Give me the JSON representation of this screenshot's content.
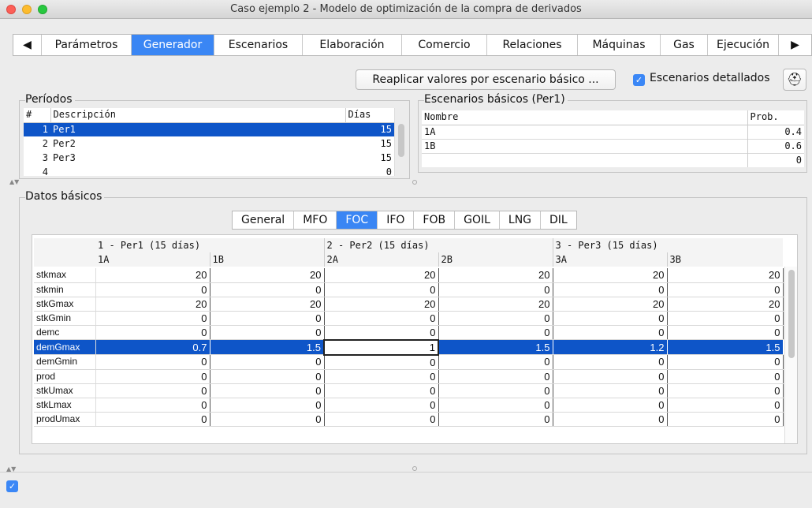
{
  "window": {
    "title": "Caso ejemplo 2 - Modelo de optimización de la compra de derivados"
  },
  "tabs": {
    "prev": "◀",
    "next": "▶",
    "items": [
      "Parámetros",
      "Generador",
      "Escenarios",
      "Elaboración",
      "Comercio",
      "Relaciones",
      "Máquinas",
      "Gas",
      "Ejecución"
    ],
    "active": "Generador"
  },
  "toolbar": {
    "replicate_label": "Reaplicar valores por escenario básico ...",
    "detailed_label": "Escenarios detallados",
    "detailed_checked": true
  },
  "periods": {
    "legend": "Períodos",
    "headers": {
      "num": "#",
      "desc": "Descripción",
      "days": "Días"
    },
    "rows": [
      {
        "num": "1",
        "desc": "Per1",
        "days": "15"
      },
      {
        "num": "2",
        "desc": "Per2",
        "days": "15"
      },
      {
        "num": "3",
        "desc": "Per3",
        "days": "15"
      },
      {
        "num": "4",
        "desc": "",
        "days": "0"
      }
    ]
  },
  "scenarios": {
    "legend": "Escenarios básicos (Per1)",
    "headers": {
      "name": "Nombre",
      "prob": "Prob."
    },
    "rows": [
      {
        "name": "1A",
        "prob": "0.4"
      },
      {
        "name": "1B",
        "prob": "0.6"
      },
      {
        "name": "",
        "prob": "0"
      }
    ]
  },
  "basic": {
    "legend": "Datos básicos",
    "subtabs": [
      "General",
      "MFO",
      "FOC",
      "IFO",
      "FOB",
      "GOIL",
      "LNG",
      "DIL"
    ],
    "active_subtab": "FOC"
  },
  "grid": {
    "period_headers": [
      "1 - Per1 (15 días)",
      "2 - Per2 (15 días)",
      "3 - Per3 (15 días)"
    ],
    "scenario_headers": [
      "1A",
      "1B",
      "2A",
      "2B",
      "3A",
      "3B"
    ],
    "rows": [
      {
        "label": "stkmax",
        "values": [
          "20",
          "20",
          "20",
          "20",
          "20",
          "20"
        ]
      },
      {
        "label": "stkmin",
        "values": [
          "0",
          "0",
          "0",
          "0",
          "0",
          "0"
        ]
      },
      {
        "label": "stkGmax",
        "values": [
          "20",
          "20",
          "20",
          "20",
          "20",
          "20"
        ]
      },
      {
        "label": "stkGmin",
        "values": [
          "0",
          "0",
          "0",
          "0",
          "0",
          "0"
        ]
      },
      {
        "label": "demc",
        "values": [
          "0",
          "0",
          "0",
          "0",
          "0",
          "0"
        ]
      },
      {
        "label": "demGmax",
        "values": [
          "0.7",
          "1.5",
          "1",
          "1.5",
          "1.2",
          "1.5"
        ]
      },
      {
        "label": "demGmin",
        "values": [
          "0",
          "0",
          "0",
          "0",
          "0",
          "0"
        ]
      },
      {
        "label": "prod",
        "values": [
          "0",
          "0",
          "0",
          "0",
          "0",
          "0"
        ]
      },
      {
        "label": "stkUmax",
        "values": [
          "0",
          "0",
          "0",
          "0",
          "0",
          "0"
        ]
      },
      {
        "label": "stkLmax",
        "values": [
          "0",
          "0",
          "0",
          "0",
          "0",
          "0"
        ]
      },
      {
        "label": "prodUmax",
        "values": [
          "0",
          "0",
          "0",
          "0",
          "0",
          "0"
        ]
      }
    ],
    "selected_row": 5,
    "editing_col": 2
  },
  "bottom": {
    "checked": true
  },
  "colors": {
    "accent": "#3a86f4",
    "selection": "#0e55c8"
  }
}
